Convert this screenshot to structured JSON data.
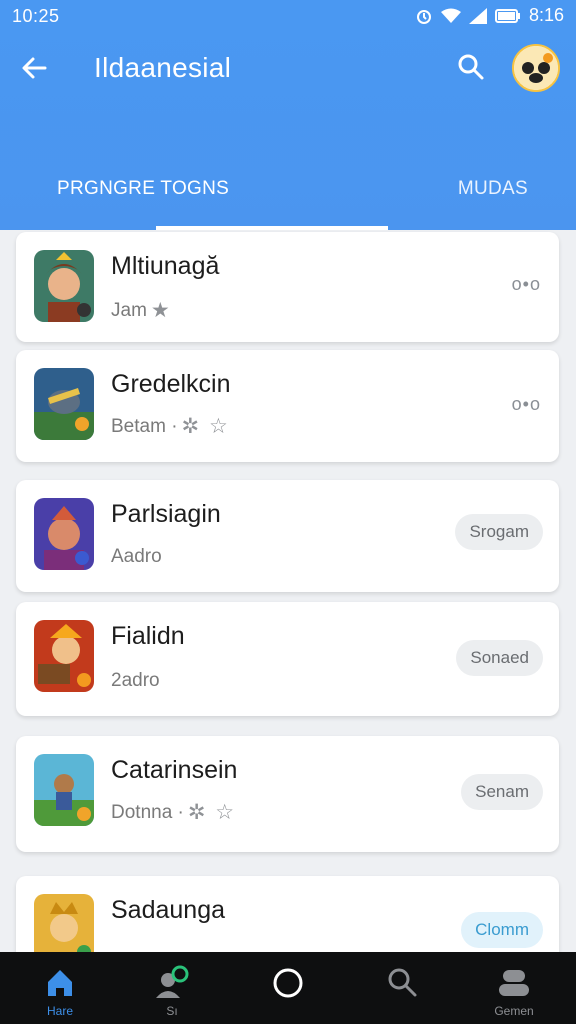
{
  "status": {
    "time": "10:25",
    "clock": "8:16"
  },
  "header": {
    "title": "Ildaanesial",
    "colors": {
      "primary": "#4a98f2"
    }
  },
  "tabs": [
    {
      "label": "PRGNGRE TOGNS"
    },
    {
      "label": "MUDAS"
    }
  ],
  "items": [
    {
      "name": "Mltiunagă",
      "sub": "Jam",
      "stars": "★",
      "action": "o•o"
    },
    {
      "name": "Gredelkcin",
      "sub": "Betam ·",
      "stars": "✲ ☆",
      "action": "o•o"
    },
    {
      "name": "Parlsiagin",
      "sub": "Aadro",
      "stars": "",
      "action": "Srogam"
    },
    {
      "name": "Fialidn",
      "sub": "2adro",
      "stars": "",
      "action": "Sonaed"
    },
    {
      "name": "Catarinsein",
      "sub": "Dotnna ·",
      "stars": "✲ ☆",
      "action": "Senam"
    },
    {
      "name": "Sadaunga",
      "sub": "",
      "stars": "",
      "action": "Clomm"
    }
  ],
  "navbar": [
    {
      "label": "Hare",
      "icon": "home-icon"
    },
    {
      "label": "Sı",
      "icon": "profile-sync-icon"
    },
    {
      "label": "",
      "icon": "home-circle-icon"
    },
    {
      "label": "",
      "icon": "search-icon"
    },
    {
      "label": "Gemen",
      "icon": "account-icon"
    }
  ]
}
